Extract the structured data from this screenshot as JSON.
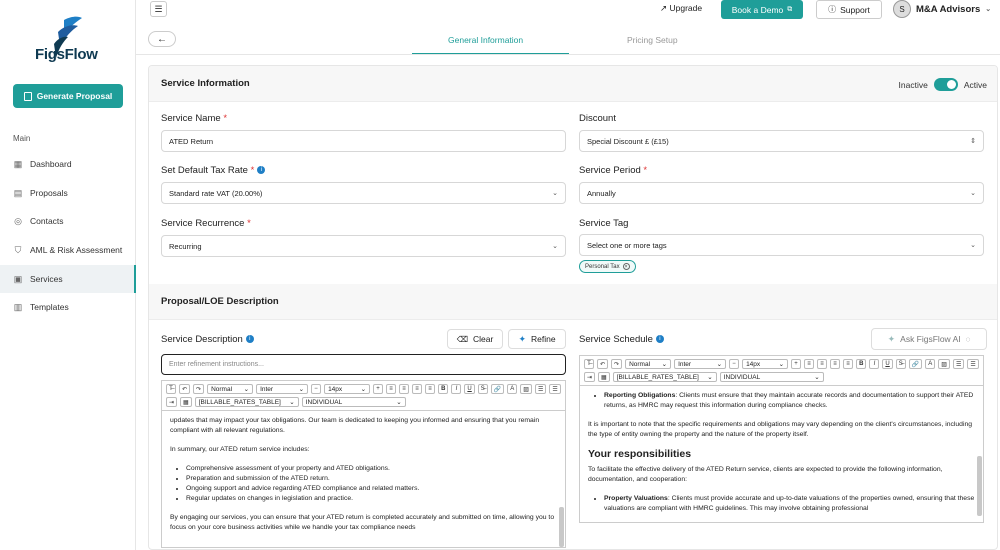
{
  "app": {
    "brand": "FigsFlow"
  },
  "sidebar": {
    "generate_label": "Generate Proposal",
    "section_label": "Main",
    "items": [
      {
        "label": "Dashboard",
        "icon": "grid-icon"
      },
      {
        "label": "Proposals",
        "icon": "proposals-icon"
      },
      {
        "label": "Contacts",
        "icon": "contacts-icon"
      },
      {
        "label": "AML & Risk Assessment",
        "icon": "shield-icon"
      },
      {
        "label": "Services",
        "icon": "services-icon",
        "active": true
      },
      {
        "label": "Templates",
        "icon": "templates-icon"
      }
    ]
  },
  "topbar": {
    "upgrade_label": "Upgrade",
    "demo_label": "Book a Demo",
    "support_label": "Support",
    "avatar_initial": "S",
    "account_name": "M&A Advisors"
  },
  "tabs": [
    {
      "label": "General Information",
      "active": true
    },
    {
      "label": "Pricing Setup",
      "active": false
    }
  ],
  "service_info": {
    "title": "Service Information",
    "status_inactive": "Inactive",
    "status_active": "Active",
    "service_name_label": "Service Name",
    "service_name_value": "ATED Return",
    "discount_label": "Discount",
    "discount_value": "Special Discount £ (£15)",
    "tax_rate_label": "Set Default Tax Rate",
    "tax_rate_value": "Standard rate VAT (20.00%)",
    "period_label": "Service Period",
    "period_value": "Annually",
    "recurrence_label": "Service Recurrence",
    "recurrence_value": "Recurring",
    "tag_label": "Service Tag",
    "tag_placeholder": "Select one or more tags",
    "tag_chip": "Personal Tax"
  },
  "proposal": {
    "title": "Proposal/LOE Description",
    "desc_label": "Service Description",
    "clear_label": "Clear",
    "refine_label": "Refine",
    "refine_placeholder": "Enter refinement instructions...",
    "schedule_label": "Service Schedule",
    "ask_label": "Ask FigsFlow AI"
  },
  "toolbar": {
    "normal": "Normal",
    "font": "Inter",
    "size": "14px",
    "table_token": "[BILLABLE_RATES_TABLE]",
    "individual": "INDIVIDUAL"
  },
  "desc_content": {
    "p1": "updates that may impact your tax obligations. Our team is dedicated to keeping you informed and ensuring that you remain compliant with all relevant regulations.",
    "p2": "In summary, our ATED return service includes:",
    "bullets": [
      "Comprehensive assessment of your property and ATED obligations.",
      "Preparation and submission of the ATED return.",
      "Ongoing support and advice regarding ATED compliance and related matters.",
      "Regular updates on changes in legislation and practice."
    ],
    "p3": "By engaging our services, you can ensure that your ATED return is completed accurately and submitted on time, allowing you to focus on your core business activities while we handle your tax compliance needs"
  },
  "schedule_content": {
    "b1_bold": "Reporting Obligations",
    "b1_text": ": Clients must ensure that they maintain accurate records and documentation to support their ATED returns, as HMRC may request this information during compliance checks.",
    "p1": "It is important to note that the specific requirements and obligations may vary depending on the client's circumstances, including the type of entity owning the property and the nature of the property itself.",
    "heading": "Your responsibilities",
    "p2": "To facilitate the effective delivery of the ATED Return service, clients are expected to provide the following information, documentation, and cooperation:",
    "b2_bold": "Property Valuations",
    "b2_text": ": Clients must provide accurate and up-to-date valuations of the properties owned, ensuring that these valuations are compliant with HMRC guidelines. This may involve obtaining professional"
  },
  "colors": {
    "accent": "#1f9e99",
    "brand_dark": "#0f3a52"
  }
}
